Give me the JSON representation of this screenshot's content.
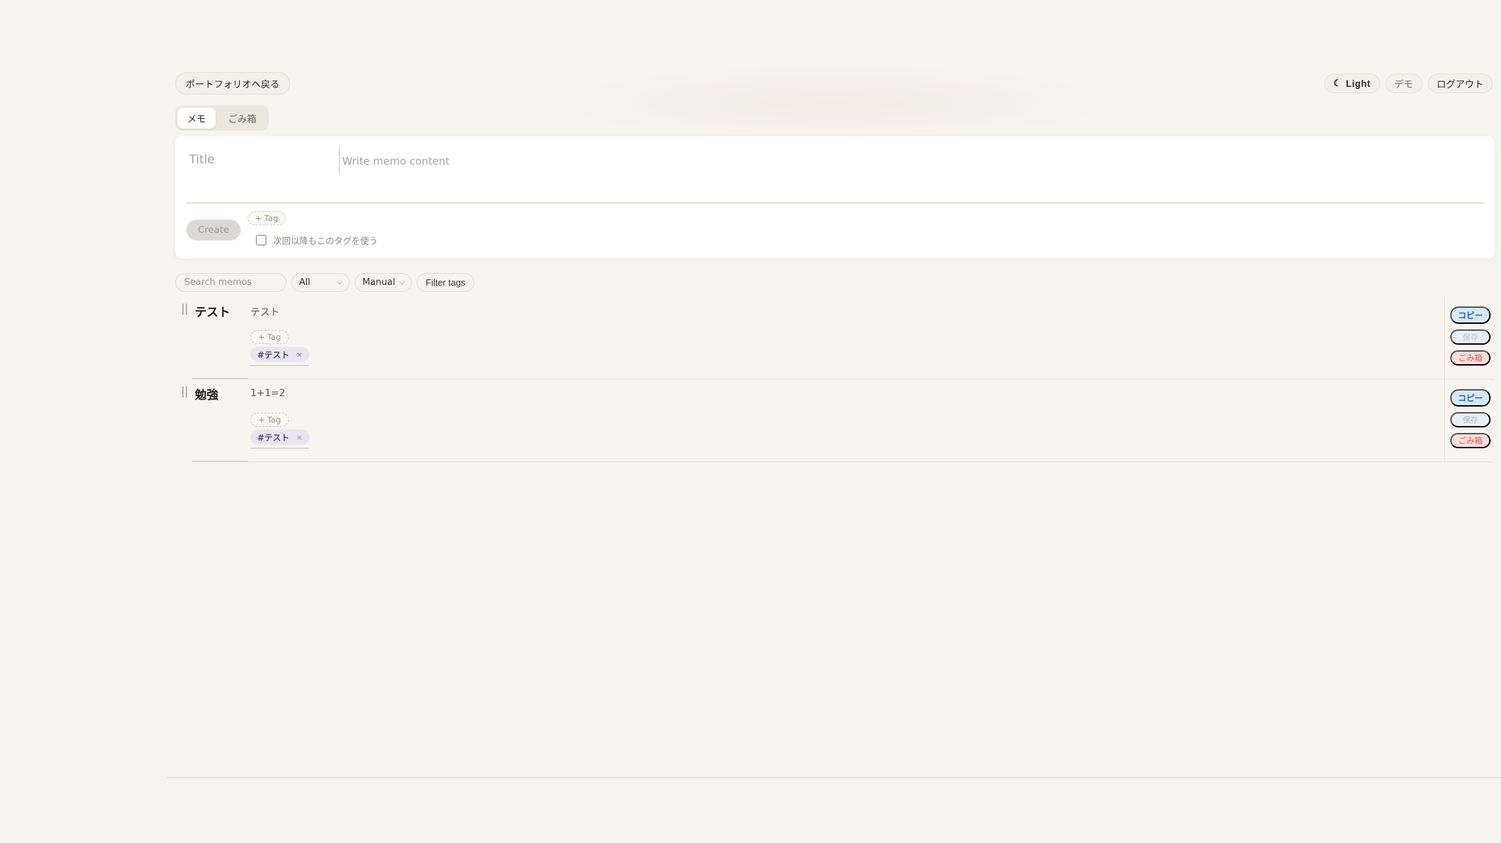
{
  "header": {
    "back_label": "ポートフォリオへ戻る",
    "theme_label": "Light",
    "theme_icon": "moon-icon",
    "demo_label": "デモ",
    "logout_label": "ログアウト"
  },
  "tabs": [
    {
      "label": "メモ",
      "active": true
    },
    {
      "label": "ごみ箱",
      "active": false
    }
  ],
  "composer": {
    "title_placeholder": "Title",
    "content_placeholder": "Write memo content",
    "create_label": "Create",
    "tag_add_label": "+ Tag",
    "remember_label": "次回以降もこのタグを使う",
    "remember_checked": false
  },
  "toolbar": {
    "search_placeholder": "Search memos",
    "filter_value": "All",
    "sort_value": "Manual",
    "filter_tags_label": "Filter tags"
  },
  "memos": [
    {
      "title": "テスト",
      "body": "テスト",
      "tag_add_label": "+ Tag",
      "tags": [
        "#テスト"
      ],
      "actions": {
        "copy": "コピー",
        "save": "保存",
        "trash": "ごみ箱"
      }
    },
    {
      "title": "勉強",
      "body": "1+1=2",
      "tag_add_label": "+ Tag",
      "tags": [
        "#テスト"
      ],
      "actions": {
        "copy": "コピー",
        "save": "保存",
        "trash": "ごみ箱"
      }
    }
  ],
  "colors": {
    "background": "#f7f4ef",
    "copy_accent": "#2a6aa6",
    "trash_accent": "#d05a5a",
    "tag_chip": "#e9e6f1"
  }
}
